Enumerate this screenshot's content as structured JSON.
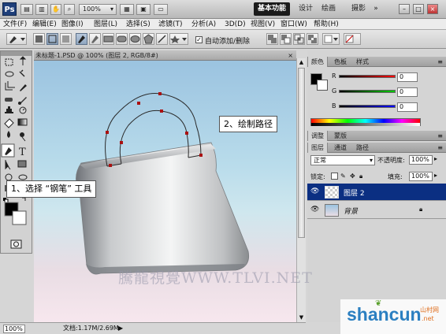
{
  "app": {
    "logo": "Ps",
    "zoom": "100%"
  },
  "workspaces": [
    "基本功能",
    "设计",
    "绘画",
    "摄影"
  ],
  "menu": [
    "文件(F)",
    "编辑(E)",
    "图像(I)",
    "图层(L)",
    "选择(S)",
    "滤镜(T)",
    "分析(A)",
    "3D(D)",
    "视图(V)",
    "窗口(W)",
    "帮助(H)"
  ],
  "options": {
    "auto_add_delete": "自动添加/删除",
    "checked": "✓"
  },
  "document": {
    "tab_title": "未标题-1.PSD @ 100% (图层 2, RGB/8#)",
    "close": "×"
  },
  "status": {
    "zoom": "100%",
    "doc_size": "文档:1.17M/2.69M"
  },
  "color_panel": {
    "tabs": [
      "颜色",
      "色板",
      "样式"
    ],
    "r_label": "R",
    "g_label": "G",
    "b_label": "B",
    "r": "0",
    "g": "0",
    "b": "0"
  },
  "layers_panel": {
    "top_tabs": [
      "调整",
      "蒙版"
    ],
    "tabs": [
      "图层",
      "通道",
      "路径"
    ],
    "blend_mode": "正常",
    "opacity_label": "不透明度:",
    "opacity": "100%",
    "lock_label": "锁定:",
    "fill_label": "填充:",
    "fill": "100%",
    "layers": [
      {
        "name": "图层 2",
        "selected": true
      },
      {
        "name": "背景",
        "selected": false
      }
    ]
  },
  "callouts": {
    "step1": "1、选择 “钢笔” 工具",
    "step2": "2、绘制路径"
  },
  "watermarks": {
    "tlvi": "騰龍視覺WWW.TLVI.NET",
    "shancun": "shancun",
    "shancun_cn": "山村网",
    "shancun_url": ".net"
  },
  "colors": {
    "accent": "#1b1b1b",
    "layer_selected": "#0b2f82",
    "r_slider": "#cc0000",
    "g_slider": "#00a000",
    "b_slider": "#0000cc"
  }
}
